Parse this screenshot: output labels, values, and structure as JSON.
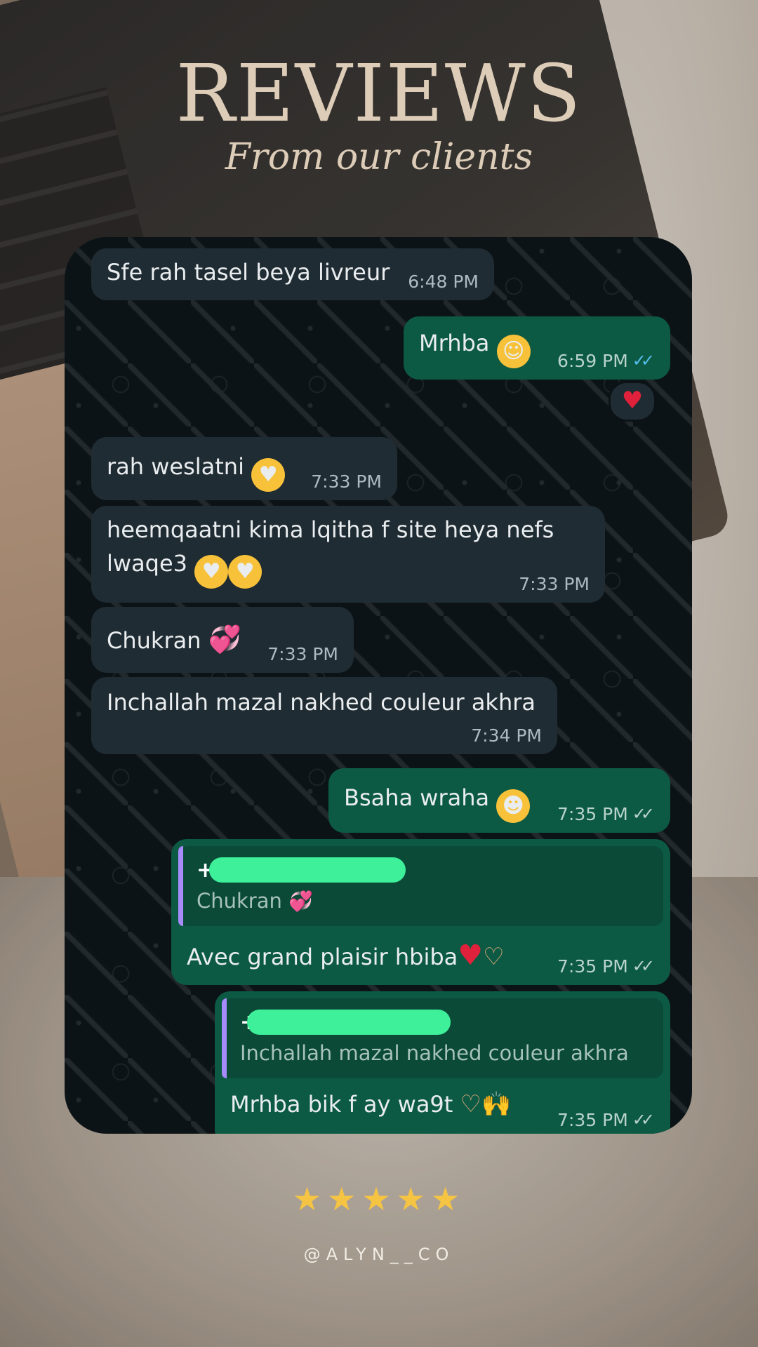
{
  "header": {
    "title": "REVIEWS",
    "subtitle": "From our clients"
  },
  "colors": {
    "incoming_bubble": "#202c33",
    "outgoing_bubble": "#0c5a43",
    "chat_background": "#0c1317",
    "read_tick": "#53bdeb",
    "title_color": "#ddcdb8",
    "star_color": "#f6c443"
  },
  "messages": [
    {
      "direction": "in",
      "text": "Sfe rah tasel beya livreur",
      "time": "6:48 PM"
    },
    {
      "direction": "out",
      "text": "Mrhba",
      "emoji": "smiling-face-icon",
      "time": "6:59 PM",
      "status": "read",
      "reaction": "red-heart-icon"
    },
    {
      "direction": "in",
      "text": "rah weslatni",
      "emoji": "heart-eyes-icon",
      "time": "7:33 PM"
    },
    {
      "direction": "in",
      "text_line1": "heemqaatni kima lqitha f site heya nefs",
      "text_line2": "lwaqe3",
      "emoji": "heart-eyes-icon",
      "time": "7:33 PM"
    },
    {
      "direction": "in",
      "text": "Chukran",
      "emoji": "revolving-hearts-icon",
      "time": "7:33 PM"
    },
    {
      "direction": "in",
      "text": "Inchallah mazal nakhed couleur akhra",
      "time": "7:34 PM"
    },
    {
      "direction": "out",
      "text": "Bsaha wraha",
      "emoji": "hugging-face-icon",
      "time": "7:35 PM",
      "status": "delivered"
    },
    {
      "direction": "out",
      "reply_to_name": "+2",
      "reply_to_text": "Chukran",
      "text": "Avec grand plaisir hbiba",
      "time": "7:35 PM",
      "status": "delivered"
    },
    {
      "direction": "out",
      "reply_to_name": "+",
      "reply_to_text": "Inchallah mazal nakhed couleur akhra",
      "text": "Mrhba bik f ay wa9t",
      "time": "7:35 PM",
      "status": "delivered"
    }
  ],
  "rating": {
    "stars": 5,
    "max": 5
  },
  "footer": {
    "handle": "@ALYN__CO"
  }
}
